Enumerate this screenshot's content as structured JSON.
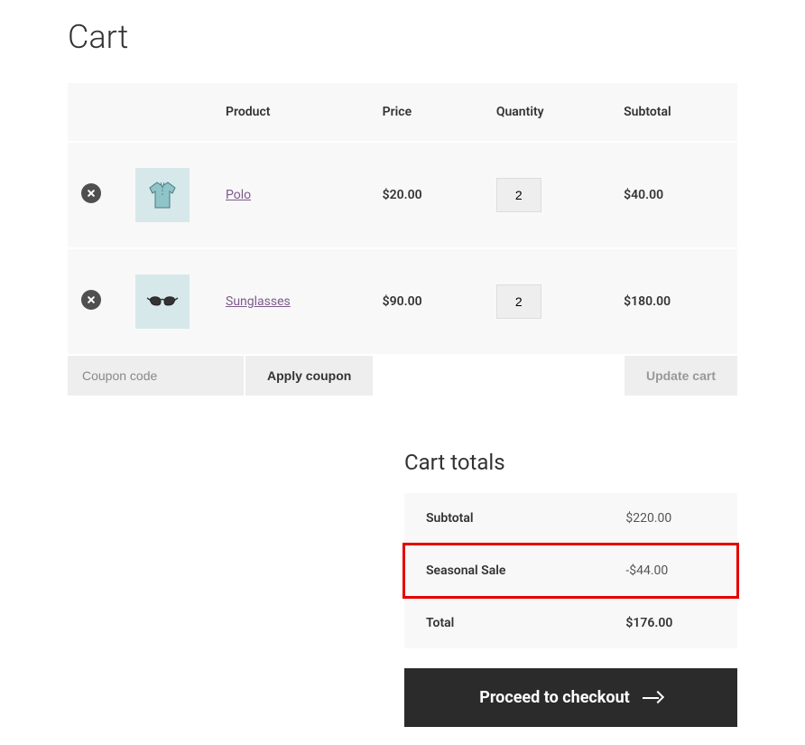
{
  "page": {
    "title": "Cart"
  },
  "table": {
    "headers": {
      "product": "Product",
      "price": "Price",
      "quantity": "Quantity",
      "subtotal": "Subtotal"
    },
    "rows": [
      {
        "product_name": "Polo",
        "price": "$20.00",
        "quantity": "2",
        "subtotal": "$40.00",
        "thumb_icon": "polo-shirt"
      },
      {
        "product_name": "Sunglasses",
        "price": "$90.00",
        "quantity": "2",
        "subtotal": "$180.00",
        "thumb_icon": "sunglasses"
      }
    ]
  },
  "coupon": {
    "placeholder": "Coupon code",
    "apply_label": "Apply coupon",
    "update_label": "Update cart"
  },
  "totals": {
    "title": "Cart totals",
    "subtotal_label": "Subtotal",
    "subtotal_value": "$220.00",
    "discount_label": "Seasonal Sale",
    "discount_value": "-$44.00",
    "total_label": "Total",
    "total_value": "$176.00",
    "checkout_label": "Proceed to checkout"
  }
}
